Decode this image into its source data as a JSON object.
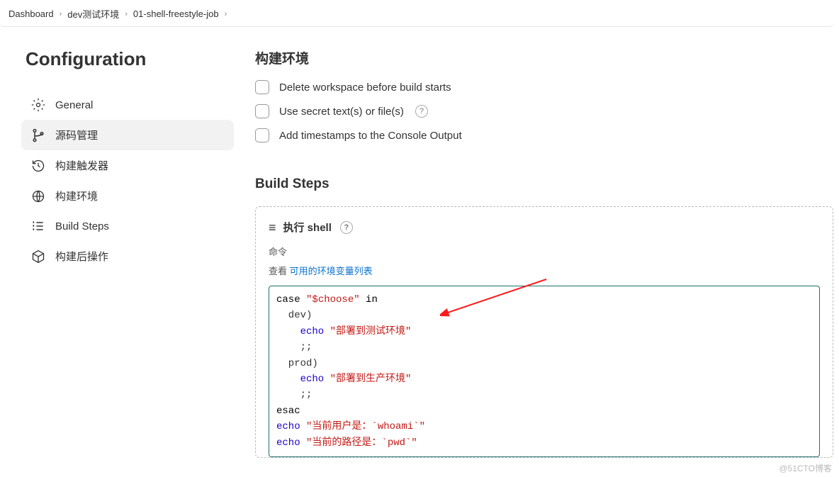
{
  "breadcrumb": {
    "items": [
      "Dashboard",
      "dev测试环境",
      "01-shell-freestyle-job"
    ]
  },
  "sidebar": {
    "title": "Configuration",
    "items": [
      {
        "label": "General"
      },
      {
        "label": "源码管理"
      },
      {
        "label": "构建触发器"
      },
      {
        "label": "构建环境"
      },
      {
        "label": "Build Steps"
      },
      {
        "label": "构建后操作"
      }
    ]
  },
  "env_section": {
    "title": "构建环境",
    "options": [
      {
        "label": "Delete workspace before build starts",
        "help": false
      },
      {
        "label": "Use secret text(s) or file(s)",
        "help": true
      },
      {
        "label": "Add timestamps to the Console Output",
        "help": false
      }
    ]
  },
  "build_steps": {
    "title": "Build Steps",
    "step": {
      "header": "执行 shell",
      "command_label": "命令",
      "hint_prefix": "查看 ",
      "hint_link": "可用的环境变量列表",
      "code": {
        "l1a": "case ",
        "l1b": "\"$choose\"",
        "l1c": " in",
        "l2": "  dev)",
        "l3a": "    echo ",
        "l3b": "\"部署到测试环境\"",
        "l4": "    ;;",
        "l5": "  prod)",
        "l6a": "    echo ",
        "l6b": "\"部署到生产环境\"",
        "l7": "    ;;",
        "l8": "esac",
        "l9a": "echo ",
        "l9b": "\"当前用户是：`whoami`\"",
        "l10a": "echo ",
        "l10b": "\"当前的路径是：`pwd`\""
      }
    }
  },
  "watermark": "@51CTO博客"
}
